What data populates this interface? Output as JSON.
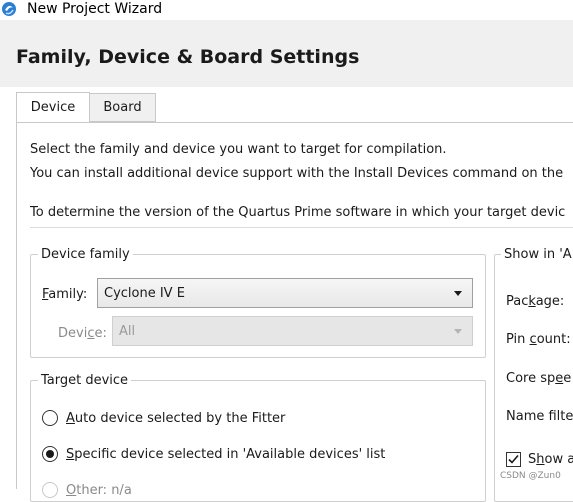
{
  "window": {
    "title": "New Project Wizard",
    "app_icon": "quartus-app-icon"
  },
  "page": {
    "title": "Family, Device & Board Settings"
  },
  "tabs": [
    {
      "label": "Device",
      "selected": true
    },
    {
      "label": "Board",
      "selected": false
    }
  ],
  "intro": {
    "line1": "Select the family and device you want to target for compilation.",
    "line2": "You can install additional device support with the Install Devices command on the",
    "line3": "To determine the version of the Quartus Prime software in which your target devic"
  },
  "device_family": {
    "group_label": "Device family",
    "family_label_prefix": "",
    "family_label_mnemonic": "F",
    "family_label_rest": "amily:",
    "family_value": "Cyclone IV E",
    "device_label_prefix": "Devi",
    "device_label_mnemonic": "c",
    "device_label_rest": "e:",
    "device_value": "All"
  },
  "target_device": {
    "group_label": "Target device",
    "options": [
      {
        "mnemonic": "A",
        "rest": "uto device selected by the Fitter",
        "selected": false
      },
      {
        "mnemonic": "S",
        "rest": "pecific device selected in 'Available devices' list",
        "selected": true
      },
      {
        "mnemonic": "O",
        "rest": "ther: n/a",
        "selected": false
      }
    ]
  },
  "show_in": {
    "group_label": "Show in 'A",
    "package_prefix": "Pac",
    "package_mnemonic": "k",
    "package_rest": "age:",
    "pin_count_prefix": "Pin ",
    "pin_count_mnemonic": "c",
    "pin_count_rest": "ount:",
    "core_speed_prefix": "Core sp",
    "core_speed_mnemonic": "e",
    "core_speed_rest": "e",
    "name_filter_label": "Name filte",
    "show_checkbox_prefix": "S",
    "show_checkbox_mnemonic": "h",
    "show_checkbox_rest": "ow a",
    "show_checked": true
  },
  "watermark": "CSDN @Zun0",
  "colors": {
    "header_band": "#f0f0f0",
    "group_border": "#cfcfcf",
    "icon_blue": "#2a7fd4"
  }
}
